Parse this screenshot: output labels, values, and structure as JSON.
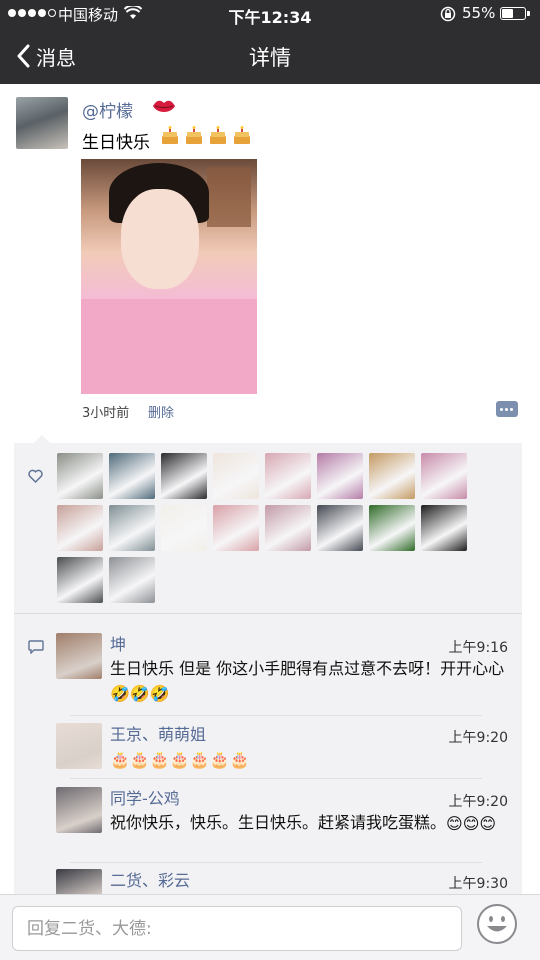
{
  "status_bar": {
    "carrier": "中国移动",
    "time": "下午12:34",
    "battery_percent": "55%",
    "battery_level": 0.55
  },
  "nav": {
    "back_label": "消息",
    "title": "详情"
  },
  "post": {
    "author": "@柠檬",
    "text": "生日快乐",
    "cake_count": 4,
    "time_ago": "3小时前",
    "delete_label": "删除"
  },
  "likes": {
    "avatar_colors": [
      "#8a8f86",
      "#4f6a7a",
      "#2a2a2e",
      "#eee5dc",
      "#d7a7b2",
      "#b47ba7",
      "#c49a62",
      "#c78aa9",
      "#c7a099",
      "#7f8f95",
      "#f2efe9",
      "#d8a0a7",
      "#c29aa6",
      "#444852",
      "#2f6b28",
      "#1c1c1c",
      "#4a4d4f",
      "#8d9095"
    ]
  },
  "comments": [
    {
      "name": "坤",
      "time": "上午9:16",
      "text": "生日快乐  但是  你这小手肥得有点过意不去呀！开开心心",
      "emoji": "🤣🤣🤣",
      "avatar_color": "#a07e6a"
    },
    {
      "name": "王京、萌萌姐",
      "time": "上午9:20",
      "text": "",
      "emoji": "🎂🎂🎂🎂🎂🎂🎂",
      "avatar_color": "#e8dcd6"
    },
    {
      "name": "同学-公鸡",
      "time": "上午9:20",
      "text": "祝你快乐，快乐。生日快乐。赶紧请我吃蛋糕。",
      "emoji": "😊😊😊",
      "avatar_color": "#6e6a70"
    },
    {
      "name": "二货、彩云",
      "time": "上午9:30",
      "text": "",
      "emoji": "",
      "avatar_color": "#3a3b44"
    }
  ],
  "reply": {
    "placeholder": "回复二货、大德:"
  }
}
